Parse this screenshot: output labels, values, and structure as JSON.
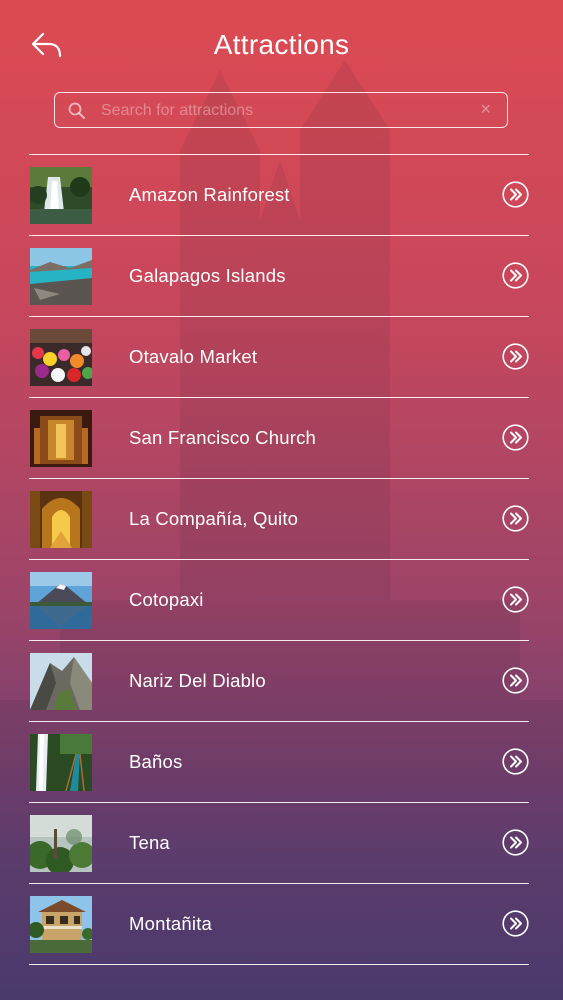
{
  "header": {
    "title": "Attractions",
    "back_icon": "back-arrow-icon"
  },
  "search": {
    "placeholder": "Search for attractions",
    "value": "",
    "clear_label": "×"
  },
  "colors": {
    "gradient_top": "#dc4a52",
    "gradient_bottom": "#4d3d72",
    "text": "#ffffff"
  },
  "attractions": [
    {
      "label": "Amazon Rainforest",
      "thumb": "waterfall-forest"
    },
    {
      "label": "Galapagos Islands",
      "thumb": "turquoise-coast"
    },
    {
      "label": "Otavalo Market",
      "thumb": "flower-market"
    },
    {
      "label": "San Francisco Church",
      "thumb": "golden-altar"
    },
    {
      "label": "La Compañía, Quito",
      "thumb": "golden-nave"
    },
    {
      "label": "Cotopaxi",
      "thumb": "volcano-lake"
    },
    {
      "label": "Nariz Del Diablo",
      "thumb": "rocky-peak"
    },
    {
      "label": "Baños",
      "thumb": "waterfall-bridge"
    },
    {
      "label": "Tena",
      "thumb": "misty-jungle"
    },
    {
      "label": "Montañita",
      "thumb": "beach-houses"
    }
  ]
}
